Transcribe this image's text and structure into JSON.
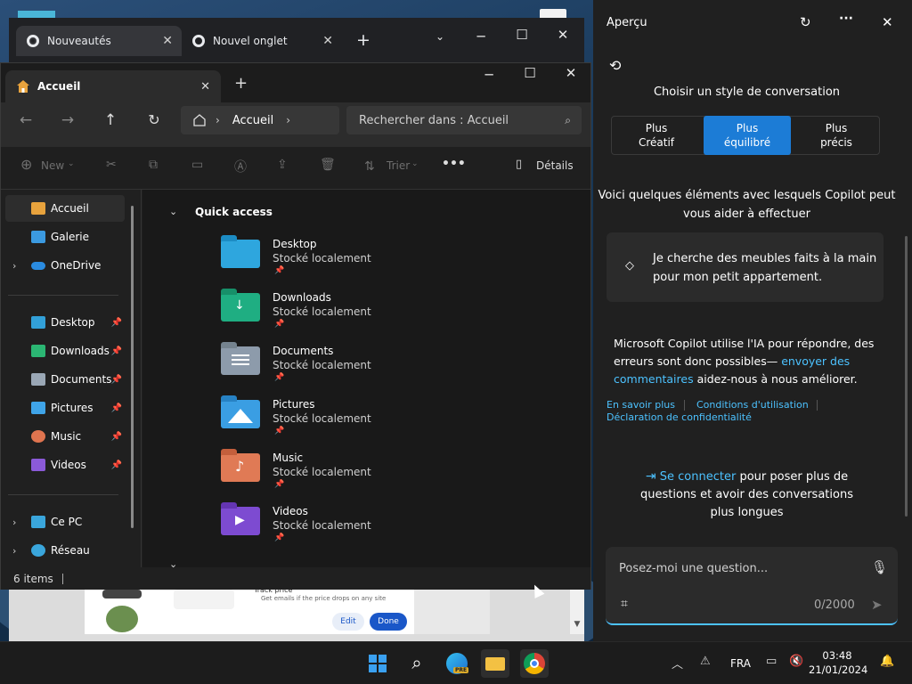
{
  "chrome": {
    "tabs": [
      {
        "label": "Nouveautés",
        "close": "✕"
      },
      {
        "label": "Nouvel onglet",
        "close": "✕"
      }
    ],
    "new_tab": "+",
    "content": {
      "track_price": "Track price",
      "track_sub": "Get emails if the price drops on any site",
      "edit": "Edit",
      "done": "Done"
    }
  },
  "explorer": {
    "tab_title": "Accueil",
    "tab_close": "✕",
    "new_tab": "+",
    "breadcrumb": [
      "Accueil"
    ],
    "search_placeholder": "Rechercher dans : Accueil",
    "cmd": {
      "new": "New",
      "sort": "Trier",
      "more": "•••",
      "details": "Détails"
    },
    "sidebar": {
      "top": [
        {
          "label": "Accueil",
          "icon": "home-icon",
          "color": "#e8a33d"
        },
        {
          "label": "Galerie",
          "icon": "gallery-icon",
          "color": "#3b9ae1"
        },
        {
          "label": "OneDrive",
          "icon": "cloud-icon",
          "color": "#2a8be0"
        }
      ],
      "pinned": [
        {
          "label": "Desktop",
          "icon": "desktop-icon",
          "color": "#32a0d8"
        },
        {
          "label": "Downloads",
          "icon": "download-icon",
          "color": "#2bb673"
        },
        {
          "label": "Documents",
          "icon": "documents-icon",
          "color": "#9aa7b5"
        },
        {
          "label": "Pictures",
          "icon": "pictures-icon",
          "color": "#3fa4e8"
        },
        {
          "label": "Music",
          "icon": "music-icon",
          "color": "#e0744f"
        },
        {
          "label": "Videos",
          "icon": "videos-icon",
          "color": "#8b5ad8"
        }
      ],
      "bottom": [
        {
          "label": "Ce PC",
          "icon": "pc-icon",
          "color": "#3aa6dc"
        },
        {
          "label": "Réseau",
          "icon": "network-icon",
          "color": "#3aa6dc"
        }
      ]
    },
    "quick_access_label": "Quick access",
    "folders": [
      {
        "name": "Desktop",
        "sub": "Stocké localement",
        "color": "#2ea6de"
      },
      {
        "name": "Downloads",
        "sub": "Stocké localement",
        "color": "#1fae82"
      },
      {
        "name": "Documents",
        "sub": "Stocké localement",
        "color": "#8d9bab"
      },
      {
        "name": "Pictures",
        "sub": "Stocké localement",
        "color": "#3a9ee3"
      },
      {
        "name": "Music",
        "sub": "Stocké localement",
        "color": "#e07a55"
      },
      {
        "name": "Videos",
        "sub": "Stocké localement",
        "color": "#7d4bd1"
      }
    ],
    "status": "6 items"
  },
  "copilot": {
    "title": "Aperçu",
    "choose_style": "Choisir un style de conversation",
    "styles": [
      {
        "line1": "Plus",
        "line2": "Créatif"
      },
      {
        "line1": "Plus",
        "line2": "équilibré"
      },
      {
        "line1": "Plus",
        "line2": "précis"
      }
    ],
    "intro_line1": "Voici quelques éléments avec lesquels Copilot peut",
    "intro_line2": "vous aider à effectuer",
    "suggestion_line1": "Je cherche des meubles faits à la main",
    "suggestion_line2": "pour mon petit appartement.",
    "disclaimer_line1": "Microsoft Copilot utilise l'IA pour répondre, des",
    "disclaimer_line2a": "erreurs sont donc possibles— ",
    "disclaimer_link1": "envoyer des",
    "disclaimer_link2": "commentaires",
    "disclaimer_line3b": " aidez-nous à nous améliorer.",
    "link_learn": "En savoir plus",
    "link_terms": "Conditions d'utilisation",
    "link_privacy": "Déclaration de confidentialité",
    "signin_link": "Se connecter",
    "signin_rest": " pour poser plus de",
    "signin_line2": "questions et avoir des conversations",
    "signin_line3": "plus longues",
    "input_placeholder": "Posez-moi une question...",
    "char_count": "0/2000",
    "accent": "#1c7cd6"
  },
  "taskbar": {
    "lang": "FRA",
    "time": "03:48",
    "date": "21/01/2024",
    "pre_badge": "PRE"
  }
}
